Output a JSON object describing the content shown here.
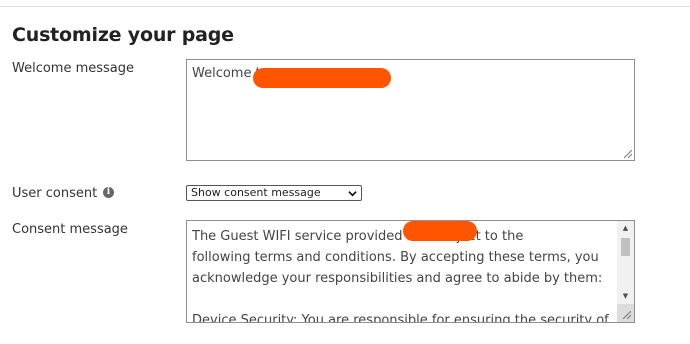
{
  "page": {
    "title": "Customize your page"
  },
  "welcome": {
    "label": "Welcome message",
    "value": "Welcome t"
  },
  "consent": {
    "label": "User consent",
    "info_icon": "info-icon",
    "selected_option": "Show consent message"
  },
  "consent_message": {
    "label": "Consent message",
    "text": "The Guest WIFI service provided b                is subject to the\nfollowing terms and conditions. By accepting these terms, you\nacknowledge your responsibilities and agree to abide by them:\n\nDevice Security: You are responsible for ensuring the security of"
  },
  "colors": {
    "redaction": "#ff5500",
    "border": "#8f8f8f",
    "text": "#333333"
  }
}
